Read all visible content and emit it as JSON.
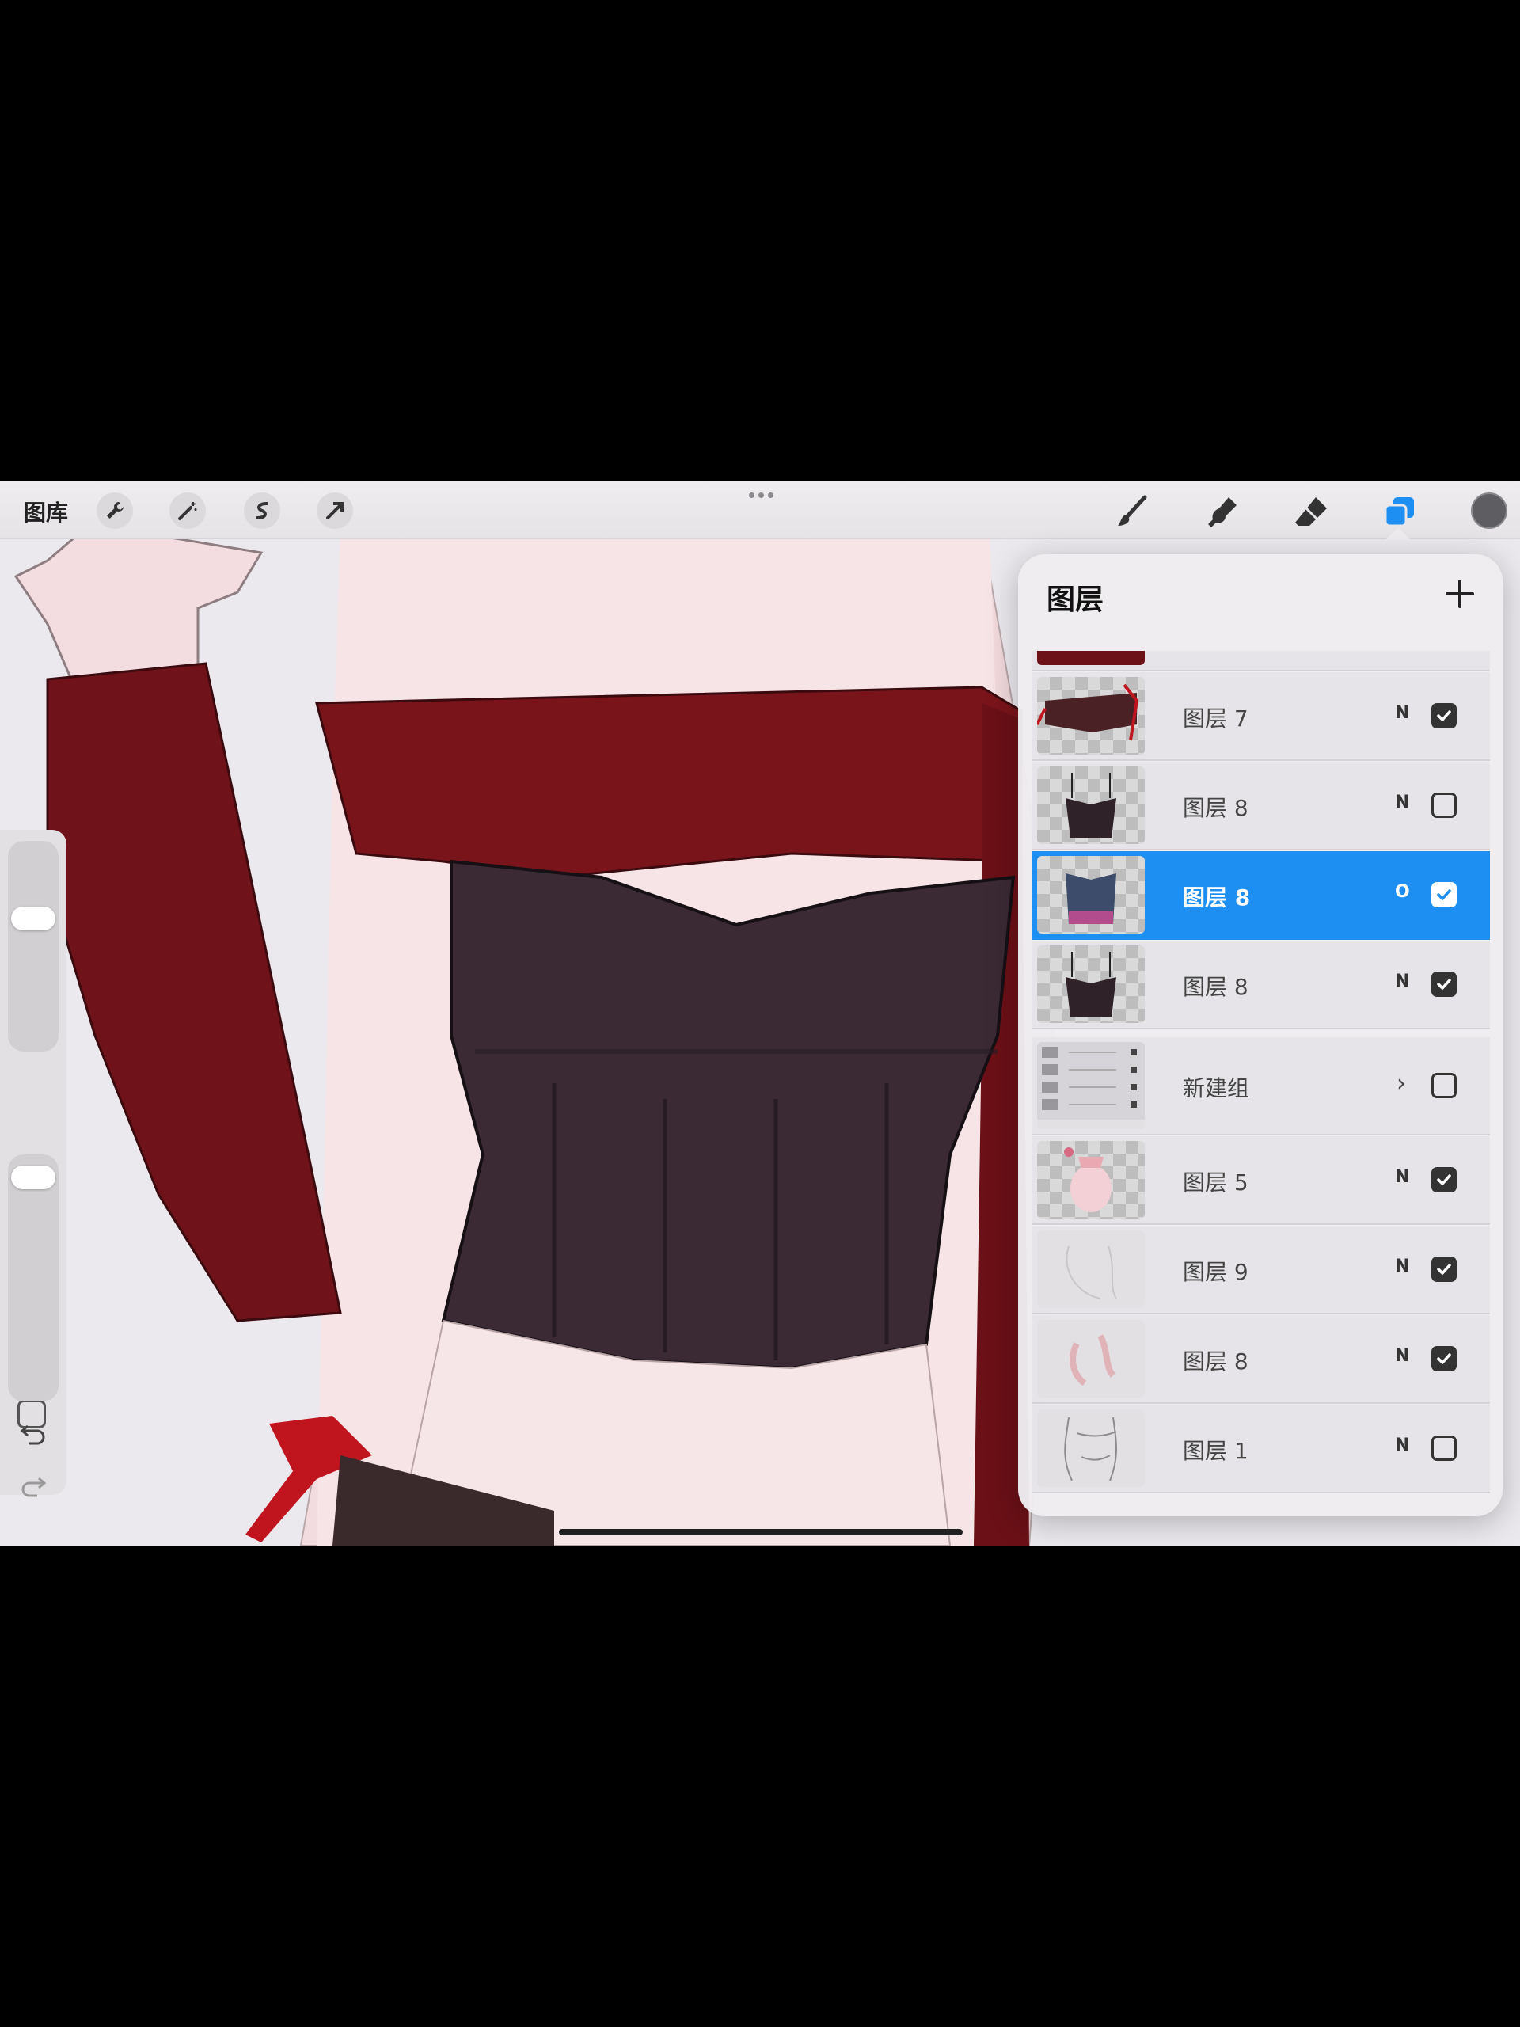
{
  "app": {
    "gallery_label": "图库"
  },
  "toolbar": {
    "left_tools": [
      "wrench-icon",
      "magic-wand-icon",
      "selection-icon",
      "transform-arrow-icon"
    ],
    "right_tools": [
      "brush-icon",
      "smudge-icon",
      "eraser-icon",
      "layers-icon"
    ],
    "current_color": "#5e5e62",
    "accent": "#1d8ff2"
  },
  "layers_panel": {
    "title": "图层",
    "layers": [
      {
        "name": "",
        "mode": "",
        "visible": true,
        "selected": false,
        "thumb": "red"
      },
      {
        "name": "图层 7",
        "mode": "N",
        "visible": true,
        "selected": false,
        "thumb": "belt"
      },
      {
        "name": "图层 8",
        "mode": "N",
        "visible": false,
        "selected": false,
        "thumb": "corset-dark"
      },
      {
        "name": "图层 8",
        "mode": "O",
        "visible": true,
        "selected": true,
        "thumb": "corset-color"
      },
      {
        "name": "图层 8",
        "mode": "N",
        "visible": true,
        "selected": false,
        "thumb": "corset-dark"
      },
      {
        "name": "新建组",
        "mode": "",
        "visible": false,
        "selected": false,
        "thumb": "group",
        "is_group": true
      },
      {
        "name": "图层 5",
        "mode": "N",
        "visible": true,
        "selected": false,
        "thumb": "body"
      },
      {
        "name": "图层 9",
        "mode": "N",
        "visible": true,
        "selected": false,
        "thumb": "faint"
      },
      {
        "name": "图层 8",
        "mode": "N",
        "visible": true,
        "selected": false,
        "thumb": "faint-red"
      },
      {
        "name": "图层 1",
        "mode": "N",
        "visible": false,
        "selected": false,
        "thumb": "sketch"
      }
    ]
  },
  "sidebar": {
    "brush_size_level": 0.65,
    "opacity_level": 0.95
  }
}
